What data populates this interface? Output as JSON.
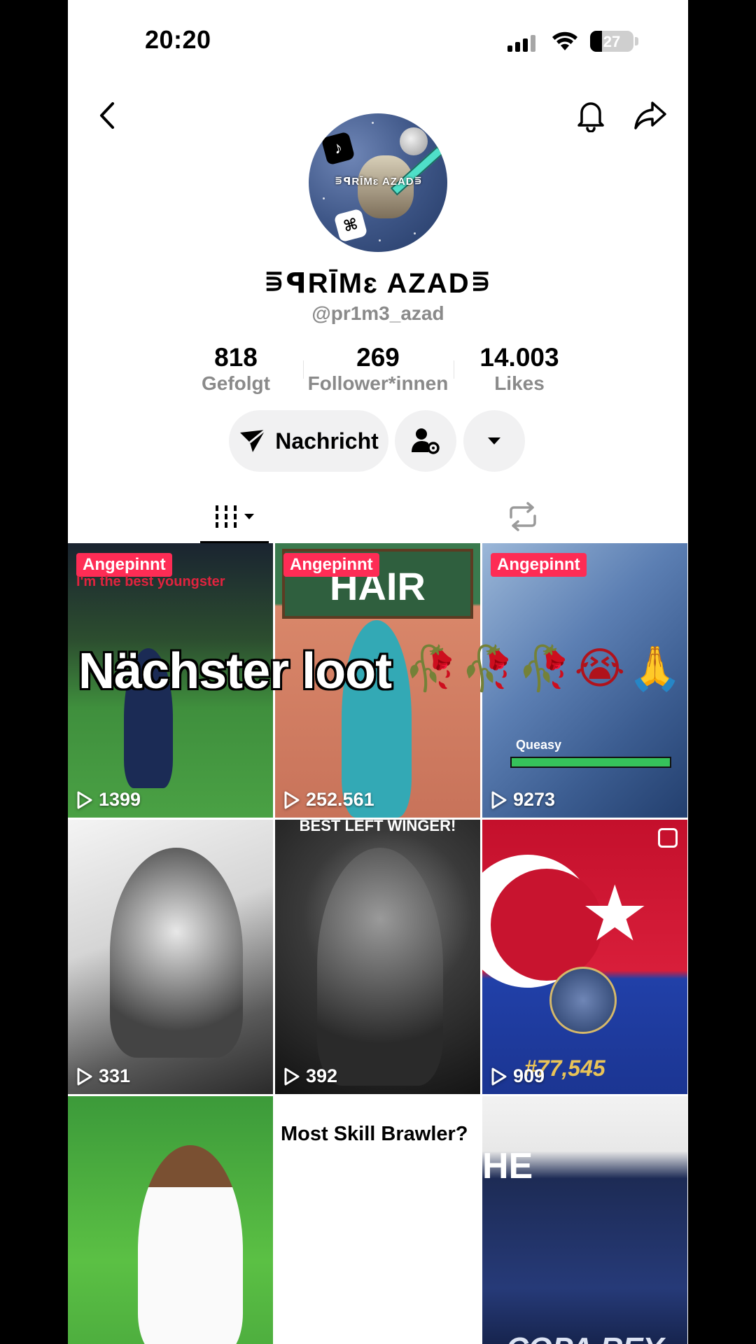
{
  "status_bar": {
    "time": "20:20",
    "battery": "27",
    "battery_level": 0.27
  },
  "profile": {
    "display_name": "⋾ꟼRĪMɛ AZAD⋾",
    "username": "@pr1m3_azad",
    "avatar_label": "⋾ꟼRĪMɛ AZAD⋾",
    "stats": [
      {
        "value": "818",
        "label": "Gefolgt"
      },
      {
        "value": "269",
        "label": "Follower*innen"
      },
      {
        "value": "14.003",
        "label": "Likes"
      }
    ],
    "message_button": "Nachricht"
  },
  "tabs": {
    "videos_icon": "grid-icon",
    "repost_icon": "repost-icon"
  },
  "video_grid": [
    {
      "pinned": "Angepinnt",
      "views": "1399",
      "overlay": "I'm the best youngster"
    },
    {
      "pinned": "Angepinnt",
      "views": "252.561",
      "overlay": "HAIR"
    },
    {
      "pinned": "Angepinnt",
      "views": "9273",
      "overlay": "Queasy"
    },
    {
      "views": "331"
    },
    {
      "views": "392",
      "overlay": "BEST LEFT WINGER!"
    },
    {
      "views": "909",
      "overlay": "#77,545"
    },
    {
      "overlay": ""
    },
    {
      "overlay": "Most Skill Brawler?"
    },
    {
      "overlay": "HE",
      "overlay2": "COPA REY"
    }
  ],
  "caption_overlay": "Nächster loot",
  "caption_emojis": "🥀🥀🥀😭🙏",
  "colors": {
    "pinned_badge": "#fe2c55",
    "muted_text": "#8a8a8a",
    "button_bg": "#f1f1f2"
  }
}
